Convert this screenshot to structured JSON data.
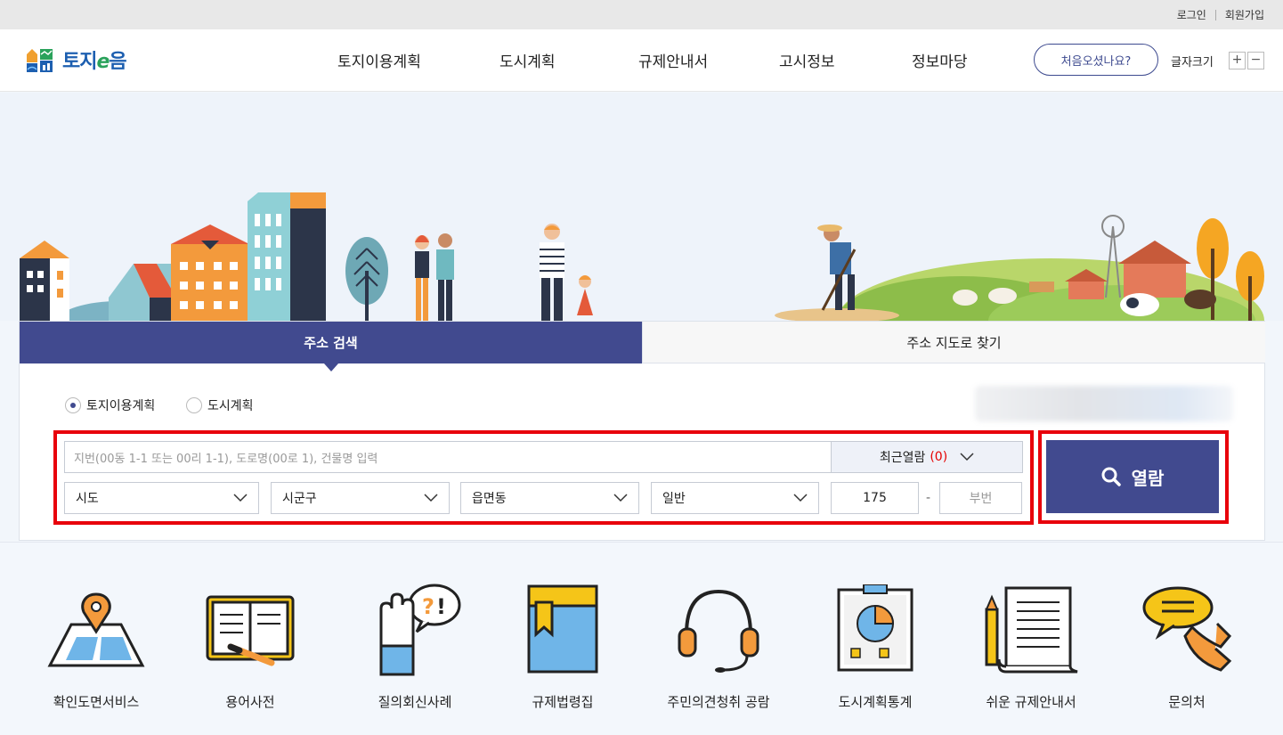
{
  "util": {
    "login": "로그인",
    "signup": "회원가입"
  },
  "header": {
    "logo_text_a": "토지",
    "logo_text_e": "e",
    "logo_text_b": "음",
    "nav": [
      "토지이용계획",
      "도시계획",
      "규제안내서",
      "고시정보",
      "정보마당"
    ],
    "first_visit": "처음오셨나요?",
    "font_size_label": "글자크기",
    "font_plus": "+",
    "font_minus": "−"
  },
  "search": {
    "tabs": {
      "address": "주소 검색",
      "map": "주소 지도로 찾기"
    },
    "radios": [
      {
        "label": "토지이용계획",
        "checked": true
      },
      {
        "label": "도시계획",
        "checked": false
      }
    ],
    "address_placeholder": "지번(00동 1-1 또는 00리 1-1), 도로명(00로 1), 건물명 입력",
    "recent_label": "최근열람",
    "recent_count": "(0)",
    "selects": {
      "sido": "시도",
      "sigungu": "시군구",
      "eupmyeondong": "읍면동",
      "type": "일반"
    },
    "main_number": "175",
    "dash": "-",
    "sub_number_placeholder": "부번",
    "view_button": "열람"
  },
  "quick_menu": [
    {
      "label": "확인도면서비스",
      "icon": "map-pin-icon"
    },
    {
      "label": "용어사전",
      "icon": "open-book-icon"
    },
    {
      "label": "질의회신사례",
      "icon": "hand-question-icon"
    },
    {
      "label": "규제법령집",
      "icon": "law-book-icon"
    },
    {
      "label": "주민의견청취 공람",
      "icon": "headset-icon"
    },
    {
      "label": "도시계획통계",
      "icon": "chart-board-icon"
    },
    {
      "label": "쉬운 규제안내서",
      "icon": "document-pencil-icon"
    },
    {
      "label": "문의처",
      "icon": "phone-chat-icon"
    }
  ],
  "colors": {
    "primary": "#414a8f",
    "highlight": "#e8000b",
    "logo_blue": "#1d5fb0",
    "logo_green": "#2aa25b"
  }
}
